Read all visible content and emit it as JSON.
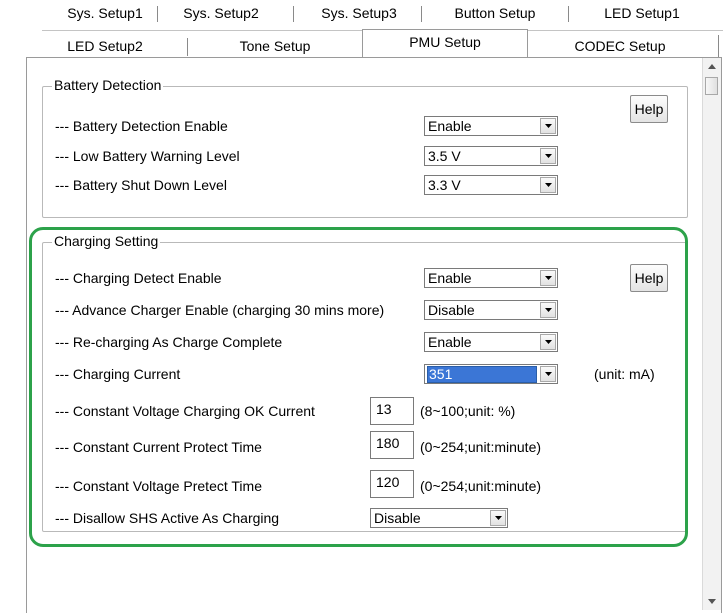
{
  "tabs_row1": [
    "Sys. Setup1",
    "Sys. Setup2",
    "Sys. Setup3",
    "Button Setup",
    "LED Setup1"
  ],
  "tabs_row2": [
    "LED Setup2",
    "Tone Setup",
    "PMU Setup",
    "CODEC Setup"
  ],
  "active_tab": "PMU Setup",
  "battery": {
    "title": "Battery Detection",
    "help": "Help",
    "rows": [
      {
        "label": "--- Battery Detection Enable",
        "value": "Enable"
      },
      {
        "label": "--- Low Battery Warning Level",
        "value": "3.5 V"
      },
      {
        "label": "--- Battery Shut Down Level",
        "value": "3.3 V"
      }
    ]
  },
  "charging": {
    "title": "Charging Setting",
    "help": "Help",
    "rows": [
      {
        "label": "--- Charging Detect Enable",
        "value": "Enable"
      },
      {
        "label": "--- Advance Charger Enable  (charging 30 mins more)",
        "value": "Disable"
      },
      {
        "label": "--- Re-charging As Charge Complete",
        "value": "Enable"
      },
      {
        "label": "--- Charging Current",
        "value": "351",
        "unit": "(unit: mA)"
      }
    ],
    "inputs": [
      {
        "label": "--- Constant Voltage Charging OK Current",
        "value": "13",
        "hint": "(8~100;unit: %)"
      },
      {
        "label": "--- Constant Current Protect Time",
        "value": "180",
        "hint": "(0~254;unit:minute)"
      },
      {
        "label": "--- Constant Voltage Pretect Time",
        "value": "120",
        "hint": "(0~254;unit:minute)"
      }
    ],
    "disallow": {
      "label": "--- Disallow SHS Active As Charging",
      "value": "Disable"
    }
  },
  "colors": {
    "highlight": "#2ca24a",
    "selection": "#3b76d6"
  },
  "icons": {
    "dropdown": "chevron-down-icon",
    "scroll_up": "arrow-up-icon",
    "scroll_down": "arrow-down-icon"
  }
}
